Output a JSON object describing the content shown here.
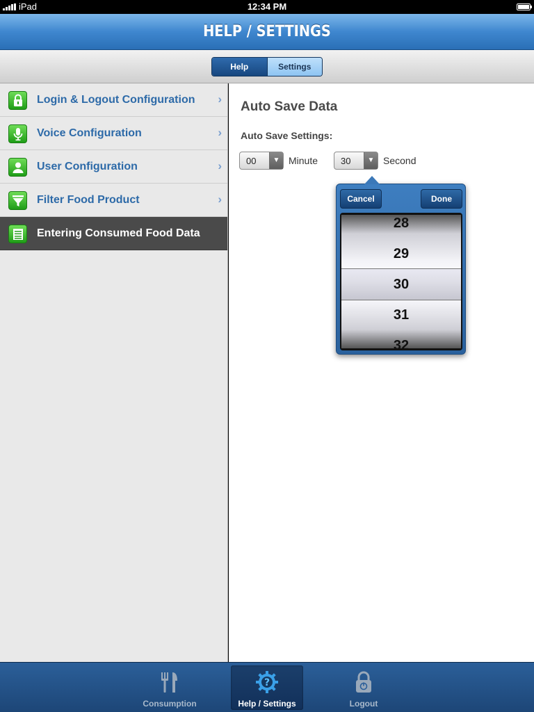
{
  "status_bar": {
    "carrier": "iPad",
    "time": "12:34 PM"
  },
  "header": {
    "title": "HELP / SETTINGS"
  },
  "segments": {
    "help": "Help",
    "settings": "Settings"
  },
  "sidebar": {
    "items": [
      {
        "label": "Login & Logout Configuration",
        "icon": "lock-icon"
      },
      {
        "label": "Voice Configuration",
        "icon": "microphone-icon"
      },
      {
        "label": "User Configuration",
        "icon": "user-icon"
      },
      {
        "label": "Filter Food Product",
        "icon": "filter-icon"
      },
      {
        "label": "Entering Consumed Food Data",
        "icon": "list-icon"
      }
    ],
    "selected_index": 4
  },
  "detail": {
    "title": "Auto Save Data",
    "settings_label": "Auto Save Settings:",
    "minute": {
      "value": "00",
      "label": "Minute"
    },
    "second": {
      "value": "30",
      "label": "Second"
    }
  },
  "popover": {
    "cancel": "Cancel",
    "done": "Done",
    "picker_items": [
      "28",
      "29",
      "30",
      "31",
      "32"
    ],
    "selected": "30"
  },
  "tabbar": {
    "tabs": [
      {
        "label": "Consumption",
        "icon": "fork-knife-icon"
      },
      {
        "label": "Help / Settings",
        "icon": "help-gear-icon"
      },
      {
        "label": "Logout",
        "icon": "padlock-power-icon"
      }
    ],
    "active_index": 1
  },
  "colors": {
    "accent_blue": "#2d6aa8",
    "header_blue": "#3f87cf",
    "selected_row": "#4a4a4a",
    "icon_green": "#1f9d17"
  }
}
